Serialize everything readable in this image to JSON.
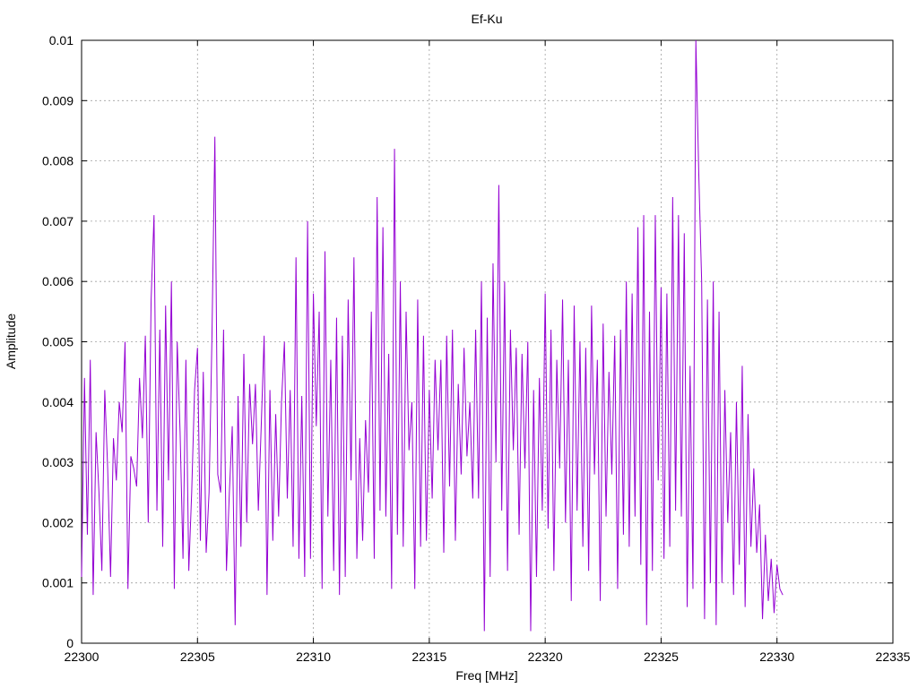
{
  "chart_data": {
    "type": "line",
    "title": "Ef-Ku",
    "xlabel": "Freq [MHz]",
    "ylabel": "Amplitude",
    "xlim": [
      22300,
      22335
    ],
    "ylim": [
      0,
      0.01
    ],
    "x_ticks": [
      "22300",
      "22305",
      "22310",
      "22315",
      "22320",
      "22325",
      "22330",
      "22335"
    ],
    "y_ticks": [
      "0",
      "0.001",
      "0.002",
      "0.003",
      "0.004",
      "0.005",
      "0.006",
      "0.007",
      "0.008",
      "0.009",
      "0.01"
    ],
    "grid": true,
    "series_color": "#9400d3",
    "series": [
      {
        "x_start": 22300.0,
        "x_step": 0.125,
        "values": [
          0.0011,
          0.0044,
          0.0018,
          0.0047,
          0.0008,
          0.0035,
          0.0025,
          0.0012,
          0.0042,
          0.0029,
          0.0011,
          0.0034,
          0.0027,
          0.004,
          0.0035,
          0.005,
          0.0009,
          0.0031,
          0.0029,
          0.0026,
          0.0044,
          0.0034,
          0.0051,
          0.002,
          0.0057,
          0.0071,
          0.0022,
          0.0052,
          0.0016,
          0.0056,
          0.0027,
          0.006,
          0.0009,
          0.005,
          0.0035,
          0.0014,
          0.0047,
          0.0012,
          0.0025,
          0.0042,
          0.0049,
          0.0017,
          0.0045,
          0.0015,
          0.0025,
          0.0051,
          0.0084,
          0.0028,
          0.0025,
          0.0052,
          0.0012,
          0.0025,
          0.0036,
          0.0003,
          0.0041,
          0.0016,
          0.0048,
          0.002,
          0.0043,
          0.0033,
          0.0043,
          0.0022,
          0.0036,
          0.0051,
          0.0008,
          0.0042,
          0.0017,
          0.0038,
          0.0021,
          0.004,
          0.005,
          0.0024,
          0.0042,
          0.0016,
          0.0064,
          0.0014,
          0.0041,
          0.0011,
          0.007,
          0.0014,
          0.0058,
          0.0036,
          0.0055,
          0.0009,
          0.0065,
          0.0021,
          0.0047,
          0.0012,
          0.0054,
          0.0008,
          0.0051,
          0.0011,
          0.0057,
          0.0027,
          0.0064,
          0.0014,
          0.0034,
          0.0017,
          0.0037,
          0.0025,
          0.0055,
          0.0014,
          0.0074,
          0.0022,
          0.0069,
          0.0021,
          0.0048,
          0.0009,
          0.0082,
          0.0018,
          0.006,
          0.0016,
          0.0055,
          0.0032,
          0.004,
          0.0009,
          0.0057,
          0.0016,
          0.0051,
          0.0017,
          0.0042,
          0.0024,
          0.0047,
          0.0032,
          0.0047,
          0.0015,
          0.0051,
          0.0026,
          0.0052,
          0.0017,
          0.0043,
          0.0028,
          0.0049,
          0.0031,
          0.004,
          0.0024,
          0.0052,
          0.0024,
          0.006,
          0.0002,
          0.0054,
          0.0011,
          0.0063,
          0.003,
          0.0076,
          0.0022,
          0.006,
          0.0012,
          0.0052,
          0.0032,
          0.0049,
          0.0018,
          0.0048,
          0.0029,
          0.005,
          0.0002,
          0.0042,
          0.0011,
          0.0044,
          0.0022,
          0.0058,
          0.0019,
          0.0052,
          0.0012,
          0.0047,
          0.0029,
          0.0057,
          0.002,
          0.0047,
          0.0007,
          0.0056,
          0.0022,
          0.005,
          0.0016,
          0.0049,
          0.0012,
          0.0056,
          0.0028,
          0.0047,
          0.0007,
          0.0053,
          0.0021,
          0.0045,
          0.0028,
          0.0051,
          0.0009,
          0.0052,
          0.0018,
          0.006,
          0.0016,
          0.0058,
          0.0021,
          0.0069,
          0.0013,
          0.0071,
          0.0003,
          0.0055,
          0.0012,
          0.0071,
          0.0027,
          0.0059,
          0.0014,
          0.0058,
          0.0016,
          0.0074,
          0.0022,
          0.0071,
          0.0021,
          0.0068,
          0.0006,
          0.0046,
          0.0009,
          0.01,
          0.0078,
          0.006,
          0.0004,
          0.0057,
          0.001,
          0.006,
          0.0003,
          0.0055,
          0.001,
          0.0042,
          0.002,
          0.0035,
          0.0008,
          0.004,
          0.0013,
          0.0046,
          0.0006,
          0.0038,
          0.0016,
          0.0029,
          0.0015,
          0.0023,
          0.0004,
          0.0018,
          0.0007,
          0.0014,
          0.0005,
          0.0013,
          0.0009,
          0.0008
        ]
      }
    ]
  }
}
